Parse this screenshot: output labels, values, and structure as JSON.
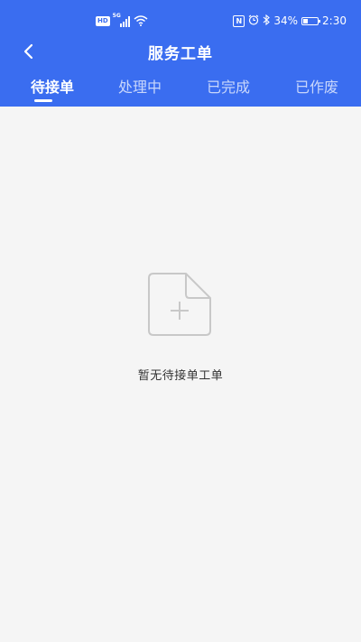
{
  "status_bar": {
    "hd": "HD",
    "network": "5G",
    "battery": "34%",
    "battery_level": 0.34,
    "time": "2:30"
  },
  "nav": {
    "title": "服务工单"
  },
  "tabs": [
    {
      "label": "待接单",
      "active": true
    },
    {
      "label": "处理中",
      "active": false
    },
    {
      "label": "已完成",
      "active": false
    },
    {
      "label": "已作废",
      "active": false
    }
  ],
  "empty_state": {
    "icon": "add-document-icon",
    "message": "暂无待接单工单"
  },
  "colors": {
    "primary": "#3a6df0",
    "background": "#f5f5f5",
    "icon_gray": "#c8c8c8",
    "text": "#333333"
  }
}
